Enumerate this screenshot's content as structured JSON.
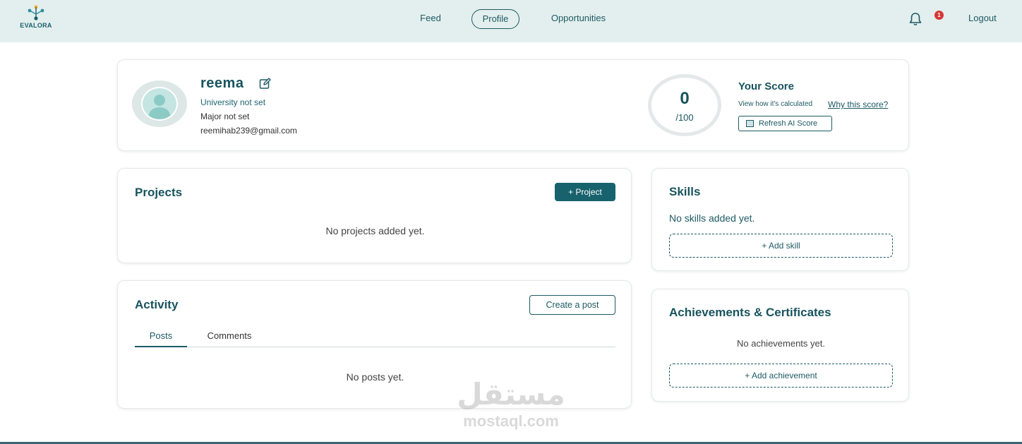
{
  "brand": {
    "name": "EVALORA"
  },
  "nav": {
    "links": [
      {
        "label": "Feed",
        "active": false
      },
      {
        "label": "Profile",
        "active": true
      },
      {
        "label": "Opportunities",
        "active": false
      }
    ],
    "notification_count": "1",
    "logout_label": "Logout"
  },
  "profile": {
    "name": "reema",
    "university": "University not set",
    "major": "Major not set",
    "email": "reemihab239@gmail.com"
  },
  "score": {
    "value": "0",
    "max": "/100",
    "title": "Your Score",
    "how_text": "View how it's calculated",
    "why_link": "Why this score?",
    "refresh_label": "Refresh AI Score"
  },
  "projects": {
    "title": "Projects",
    "add_label": "+ Project",
    "empty": "No projects added yet."
  },
  "activity": {
    "title": "Activity",
    "create_label": "Create a post",
    "tabs": [
      {
        "label": "Posts",
        "active": true
      },
      {
        "label": "Comments",
        "active": false
      }
    ],
    "empty": "No posts yet."
  },
  "skills": {
    "title": "Skills",
    "empty": "No skills added yet.",
    "add_label": "+ Add skill"
  },
  "achievements": {
    "title": "Achievements & Certificates",
    "empty": "No achievements yet.",
    "add_label": "+ Add achievement"
  },
  "watermark": {
    "arabic": "مستقل",
    "latin": "mostaql.com"
  },
  "colors": {
    "primary": "#17626c",
    "header_bg": "#e3efee",
    "badge": "#d63636"
  }
}
